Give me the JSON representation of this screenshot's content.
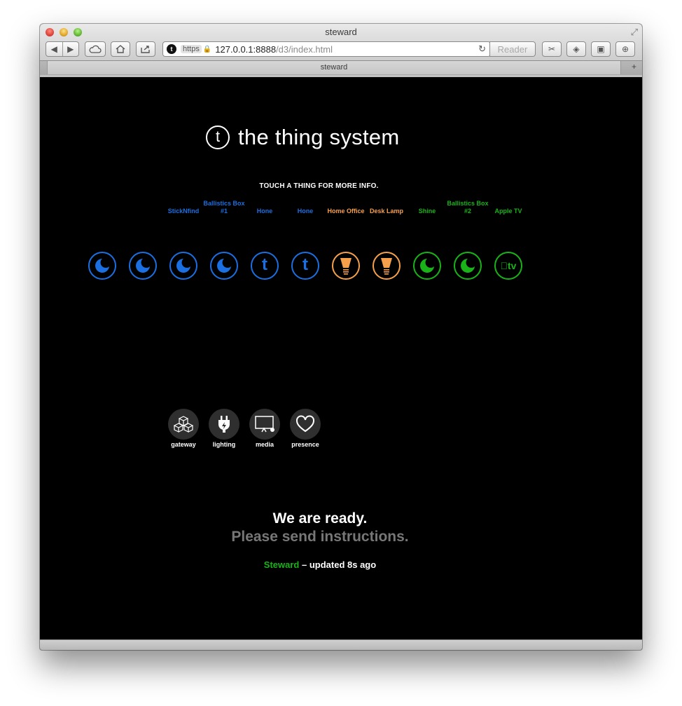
{
  "window": {
    "title": "steward",
    "tab_title": "steward",
    "url_protocol": "https",
    "url_host": "127.0.0.1:8888",
    "url_path": "/d3/index.html",
    "reader_label": "Reader"
  },
  "header": {
    "logo_glyph": "t",
    "logo_text": "the thing system",
    "prompt": "TOUCH A THING FOR MORE INFO."
  },
  "things": [
    {
      "label": "",
      "icon": "moon-icon",
      "color": "#1b6fe0"
    },
    {
      "label": "",
      "icon": "moon-icon",
      "color": "#1b6fe0"
    },
    {
      "label": "StickNfind",
      "icon": "moon-icon",
      "color": "#1b6fe0"
    },
    {
      "label": "Ballistics Box #1",
      "icon": "moon-icon",
      "color": "#1b6fe0"
    },
    {
      "label": "Hone",
      "icon": "t-icon",
      "color": "#1b6fe0"
    },
    {
      "label": "Hone",
      "icon": "t-icon",
      "color": "#1b6fe0"
    },
    {
      "label": "Home Office",
      "icon": "bulb-icon",
      "color": "#f7a04c"
    },
    {
      "label": "Desk Lamp",
      "icon": "bulb-icon",
      "color": "#f7a04c"
    },
    {
      "label": "Shine",
      "icon": "moon-icon",
      "color": "#19b319"
    },
    {
      "label": "Ballistics Box #2",
      "icon": "moon-icon",
      "color": "#19b319"
    },
    {
      "label": "Apple TV",
      "icon": "appletv-icon",
      "color": "#19b319",
      "glyph": "tv"
    }
  ],
  "categories": [
    {
      "label": "gateway",
      "icon": "cubes-icon"
    },
    {
      "label": "lighting",
      "icon": "plug-icon"
    },
    {
      "label": "media",
      "icon": "monitor-icon"
    },
    {
      "label": "presence",
      "icon": "heart-icon"
    }
  ],
  "status": {
    "ready": "We are ready.",
    "instructions": "Please send instructions.",
    "steward": "Steward",
    "updated": " – updated 8s ago"
  }
}
